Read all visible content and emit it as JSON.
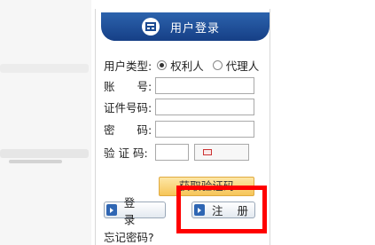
{
  "header": {
    "title": "用户登录",
    "icon": "login-badge-icon"
  },
  "user_type": {
    "label": "用户类型:",
    "options": [
      {
        "label": "权利人",
        "checked": true
      },
      {
        "label": "代理人",
        "checked": false
      }
    ]
  },
  "fields": {
    "account_label": "账　　号:",
    "id_label": "证件号码:",
    "password_label": "密　　码:",
    "captcha_label": "验 证 码:"
  },
  "buttons": {
    "get_code": "获取验证码",
    "login": "登 录",
    "register": "注 册"
  },
  "forgot_password": "忘记密码?",
  "colors": {
    "header": "#1b4a92",
    "highlight": "#ff0000",
    "code_button": "#f6c558"
  }
}
